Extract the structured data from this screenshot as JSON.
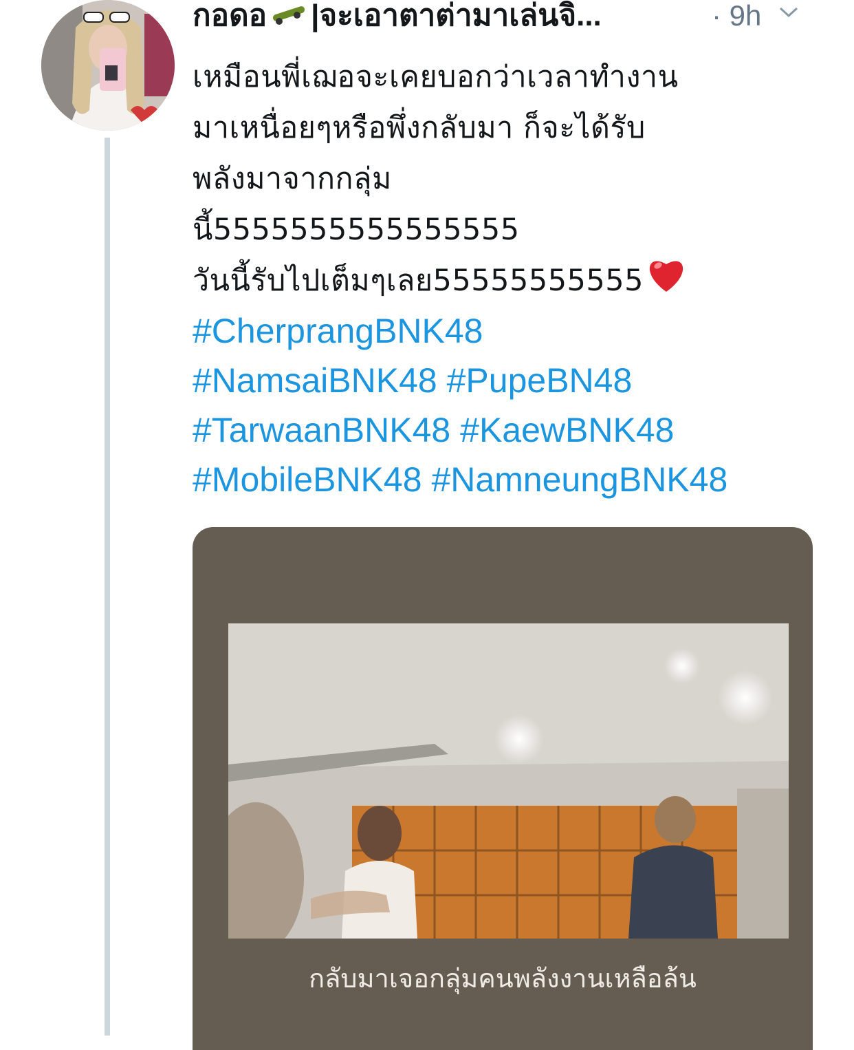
{
  "tweet": {
    "author_name": "กอดอ",
    "author_name_rest": "|จะเอาตาต่ามาเล่นจิ...",
    "time": "· 9h",
    "text_lines": [
      "เหมือนพี่เฌอจะเคยบอกว่าเวลาทำงาน",
      "มาเหนื่อยๆหรือพึ่งกลับมา ก็จะได้รับ",
      "พลังมาจากกลุ่ม",
      "นี้5555555555555555",
      "วันนี้รับไปเต็มๆเลย55555555555"
    ],
    "hashtags": [
      "#CherprangBNK48",
      "#NamsaiBNK48",
      "#PupeBN48",
      "#TarwaanBNK48",
      "#KaewBNK48",
      "#MobileBNK48",
      "#NamneungBNK48"
    ],
    "media": {
      "caption": "กลับมาเจอกลุ่มคนพลังงานเหลือล้น"
    }
  },
  "icons": {
    "avatar": "profile-photo",
    "skateboard": "skateboard-emoji",
    "heart": "red-heart-emoji",
    "menu": "chevron-down-icon"
  },
  "colors": {
    "hashtag": "#1b95e0",
    "text": "#14171a",
    "meta": "#657786",
    "thread_line": "#ccd6dd"
  }
}
